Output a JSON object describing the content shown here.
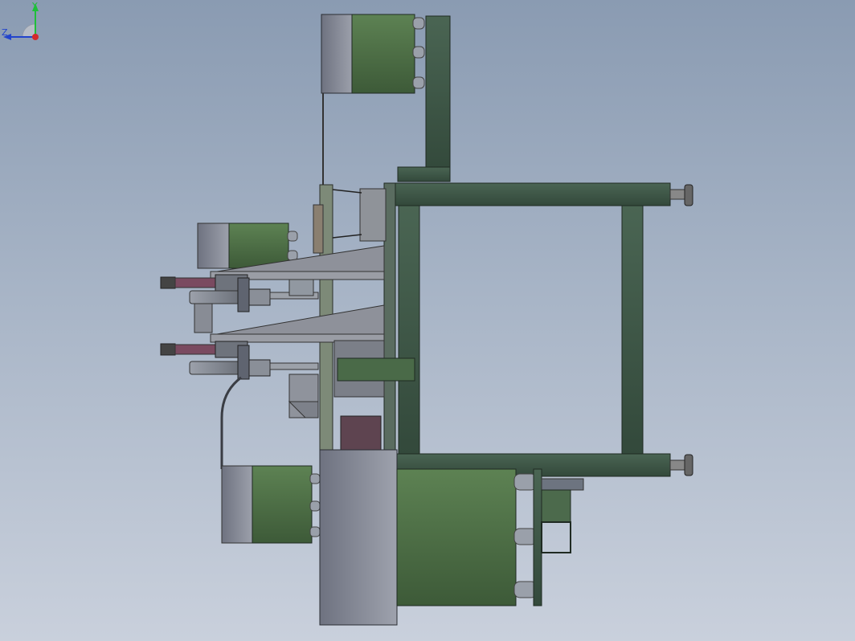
{
  "viewport": {
    "background_top": "#8a9bb2",
    "background_bottom": "#c9d0dc"
  },
  "triad": {
    "y_label": "Y",
    "z_label": "Z",
    "y_color": "#1fbf3a",
    "z_color": "#2244cc",
    "x_color": "#d42a2a"
  },
  "colors": {
    "frame_green": "#3f5848",
    "frame_edge": "#1f2a22",
    "motor_green": "#567a4c",
    "motor_grey": "#7d8089",
    "cylinder_maroon": "#7a4a60",
    "plate_grey": "#8e919a"
  }
}
